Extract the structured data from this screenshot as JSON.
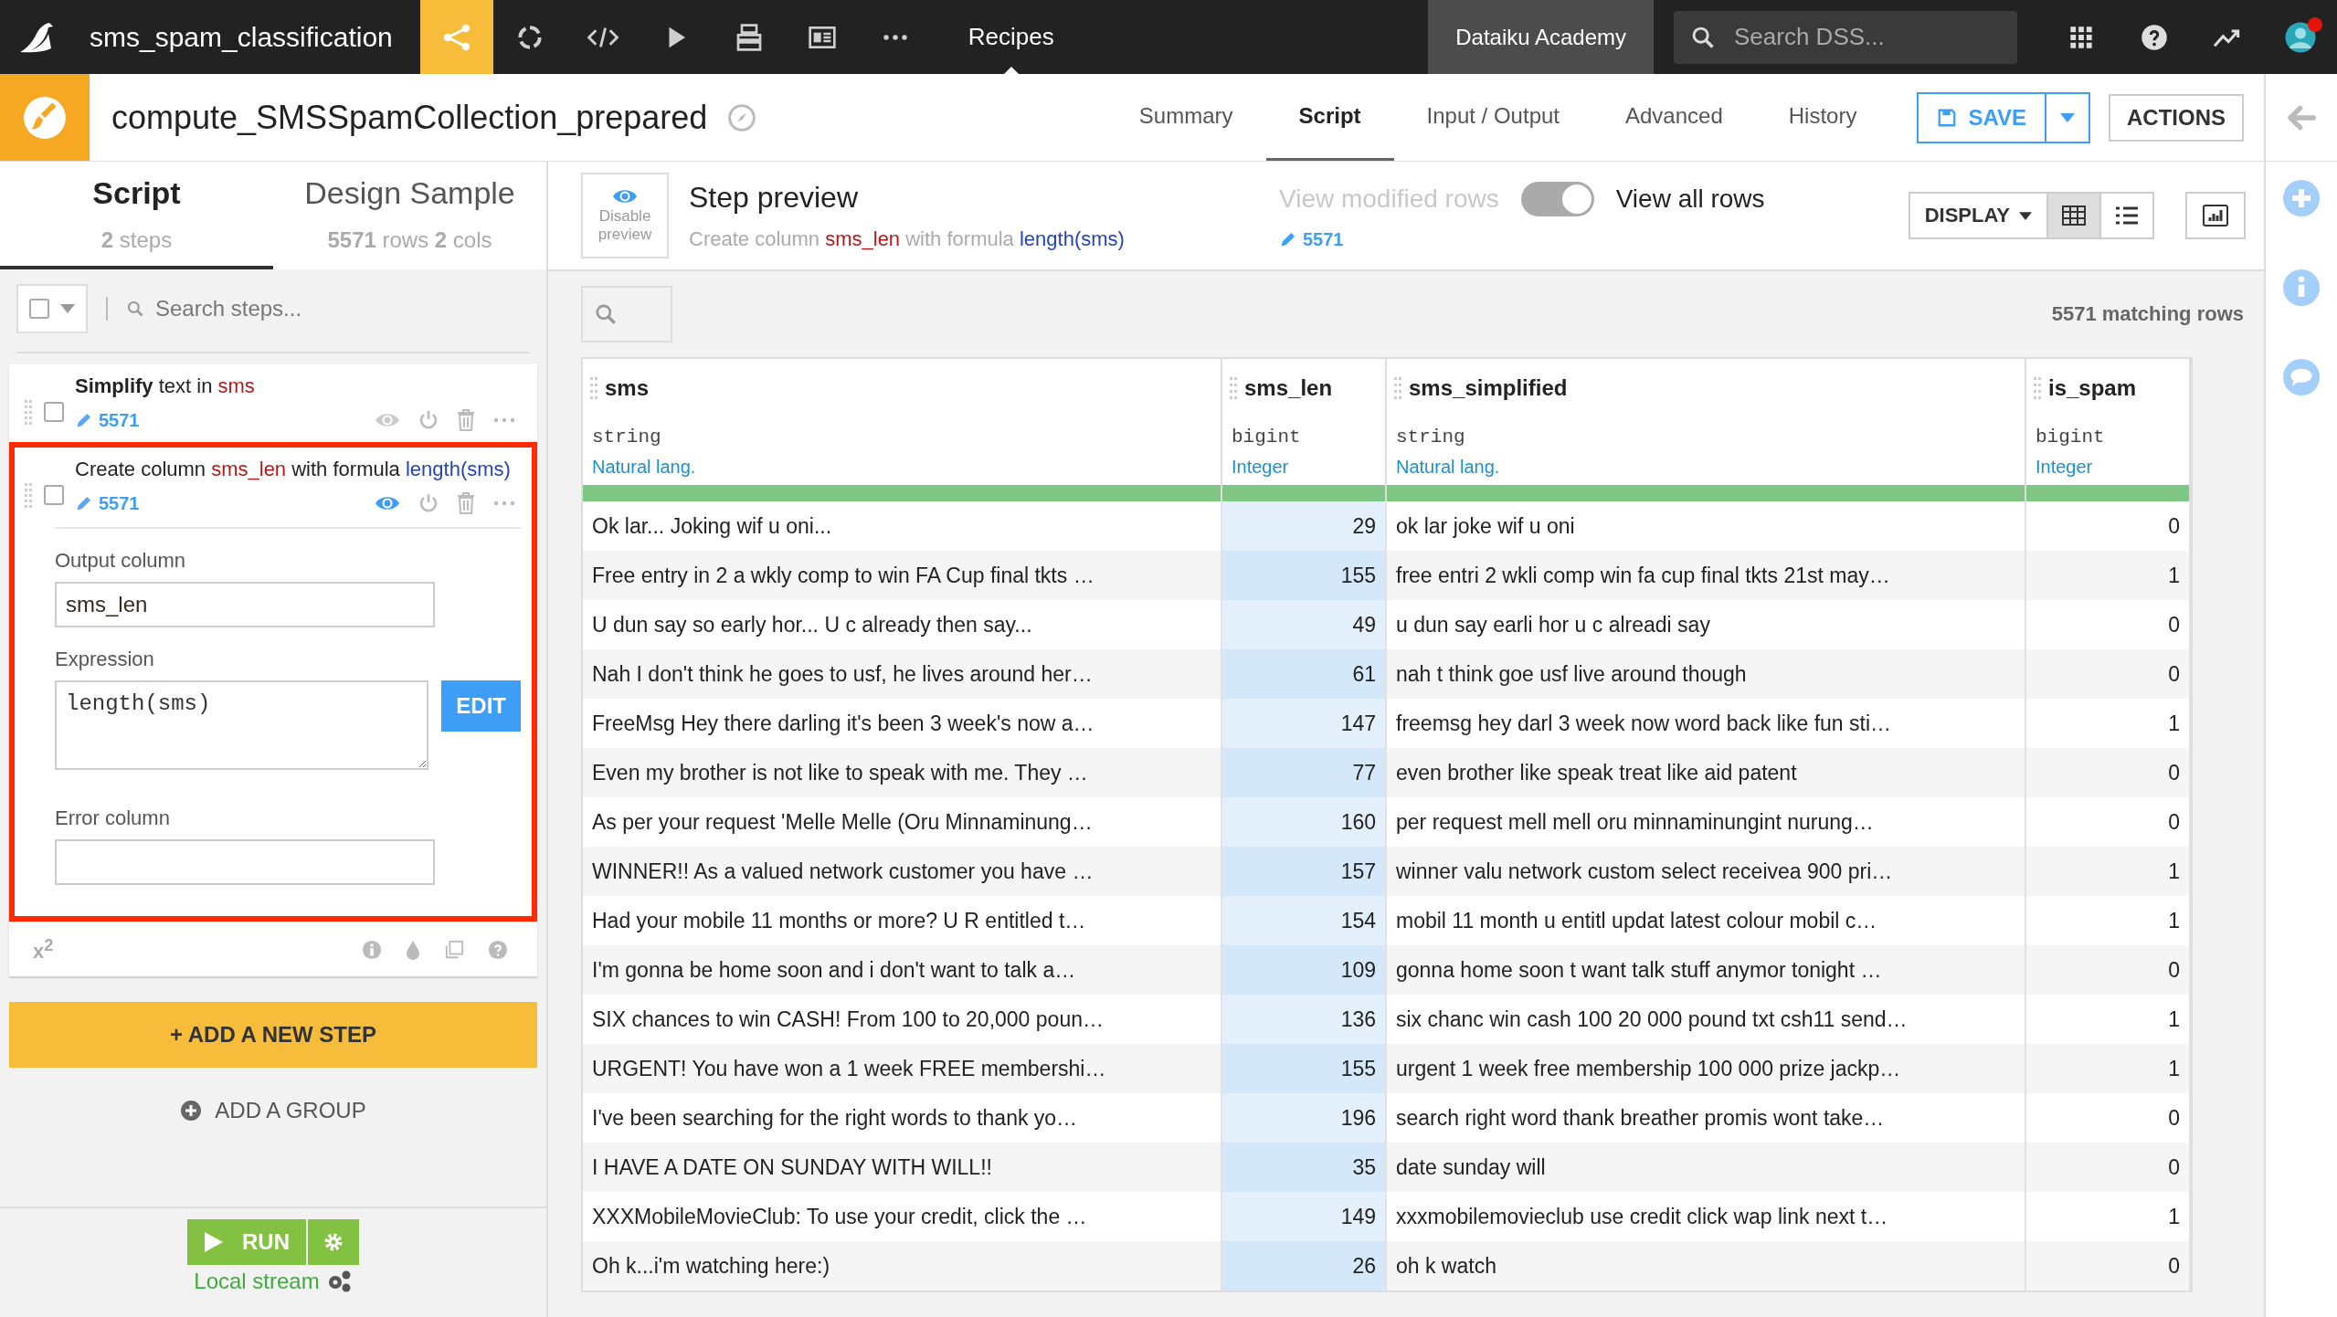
{
  "topbar": {
    "project": "sms_spam_classification",
    "nav": [
      {
        "kind": "flow",
        "selected": true
      },
      {
        "kind": "lab",
        "selected": false
      },
      {
        "kind": "code",
        "selected": false
      },
      {
        "kind": "run",
        "selected": false
      },
      {
        "kind": "deploy",
        "selected": false
      },
      {
        "kind": "dashboard",
        "selected": false
      },
      {
        "kind": "more",
        "selected": false
      }
    ],
    "section": "Recipes",
    "academy": "Dataiku Academy",
    "search": {
      "placeholder": "Search DSS..."
    },
    "notification": true
  },
  "recipe": {
    "title": "compute_SMSSpamCollection_prepared",
    "tabs": [
      {
        "label": "Summary",
        "selected": false
      },
      {
        "label": "Script",
        "selected": true
      },
      {
        "label": "Input / Output",
        "selected": false
      },
      {
        "label": "Advanced",
        "selected": false
      },
      {
        "label": "History",
        "selected": false
      }
    ],
    "save": "SAVE",
    "actions": "ACTIONS"
  },
  "sidebar": {
    "tabs": [
      {
        "label": "Script",
        "sub": "**2** steps",
        "selected": true
      },
      {
        "label": "Design Sample",
        "sub": "**5571** rows **2** cols",
        "selected": false
      }
    ],
    "search": {
      "placeholder": "Search steps..."
    },
    "steps": [
      {
        "title": [
          {
            "text": "Simplify",
            "kind": "action"
          },
          {
            "text": " text in ",
            "kind": "plain"
          },
          {
            "text": "sms",
            "kind": "column"
          }
        ],
        "count": "5571",
        "checked": false,
        "preview": false,
        "highlighted": false
      },
      {
        "title": [
          {
            "text": "Create column ",
            "kind": "plain"
          },
          {
            "text": "sms_len",
            "kind": "column"
          },
          {
            "text": " with formula ",
            "kind": "plain"
          },
          {
            "text": "length(sms)",
            "kind": "formula"
          }
        ],
        "count": "5571",
        "checked": false,
        "preview": true,
        "highlighted": true,
        "fields": [
          {
            "kind": "input",
            "label": "Output column",
            "value": "sms_len"
          },
          {
            "kind": "code",
            "label": "Expression",
            "value": "length(sms)",
            "button": "EDIT"
          },
          {
            "kind": "input",
            "label": "Error column"
          }
        ]
      }
    ],
    "footer": "x$^{2}$",
    "add_step": "+ ADD A NEW STEP",
    "add_group": "ADD A GROUP",
    "run": "RUN",
    "engine": "Local stream"
  },
  "preview": {
    "disable": "Disable preview",
    "title": "Step preview",
    "description": [
      {
        "text": "Create column ",
        "kind": "plain"
      },
      {
        "text": "sms_len",
        "kind": "column"
      },
      {
        "text": " with formula ",
        "kind": "plain"
      },
      {
        "text": "length(sms)",
        "kind": "formula"
      }
    ],
    "modified_label": "View modified rows",
    "all_label": "View all rows",
    "show_all": true,
    "count": "5571",
    "display": "DISPLAY",
    "views": [
      {
        "kind": "table",
        "selected": true
      },
      {
        "kind": "list",
        "selected": false
      }
    ],
    "matching": "5571 matching rows"
  },
  "table": {
    "columns": [
      {
        "name": "sms",
        "type": "string",
        "meaning": "Natural lang.",
        "kind": "text",
        "modified": false
      },
      {
        "name": "sms_len",
        "type": "bigint",
        "meaning": "Integer",
        "kind": "number",
        "modified": true
      },
      {
        "name": "sms_simplified",
        "type": "string",
        "meaning": "Natural lang.",
        "kind": "text",
        "modified": false
      },
      {
        "name": "is_spam",
        "type": "bigint",
        "meaning": "Integer",
        "kind": "number",
        "modified": false
      }
    ],
    "rows": [
      [
        "Ok lar... Joking wif u oni...",
        "29",
        "ok lar joke wif u oni",
        "0"
      ],
      [
        "Free entry in 2 a wkly comp to win FA Cup final tkts …",
        "155",
        "free entri 2 wkli comp win fa cup final tkts 21st may…",
        "1"
      ],
      [
        "U dun say so early hor... U c already then say...",
        "49",
        "u dun say earli hor u c alreadi say",
        "0"
      ],
      [
        "Nah I don't think he goes to usf, he lives around her…",
        "61",
        "nah t think goe usf live around though",
        "0"
      ],
      [
        "FreeMsg Hey there darling it's been 3 week's now a…",
        "147",
        "freemsg hey darl 3 week now word back like fun sti…",
        "1"
      ],
      [
        "Even my brother is not like to speak with me. They …",
        "77",
        "even brother like speak treat like aid patent",
        "0"
      ],
      [
        "As per your request 'Melle Melle (Oru Minnaminung…",
        "160",
        "per request mell mell oru minnaminungint nurung…",
        "0"
      ],
      [
        "WINNER!! As a valued network customer you have …",
        "157",
        "winner valu network custom select receivea 900 pri…",
        "1"
      ],
      [
        "Had your mobile 11 months or more? U R entitled t…",
        "154",
        "mobil 11 month u entitl updat latest colour mobil c…",
        "1"
      ],
      [
        "I'm gonna be home soon and i don't want to talk a…",
        "109",
        "gonna home soon t want talk stuff anymor tonight …",
        "0"
      ],
      [
        "SIX chances to win CASH! From 100 to 20,000 poun…",
        "136",
        "six chanc win cash 100 20 000 pound txt csh11 send…",
        "1"
      ],
      [
        "URGENT! You have won a 1 week FREE membershi…",
        "155",
        "urgent 1 week free membership 100 000 prize jackp…",
        "1"
      ],
      [
        "I've been searching for the right words to thank yo…",
        "196",
        "search right word thank breather promis wont take…",
        "0"
      ],
      [
        "I HAVE A DATE ON SUNDAY WITH WILL!!",
        "35",
        "date sunday will",
        "0"
      ],
      [
        "XXXMobileMovieClub: To use your credit, click the …",
        "149",
        "xxxmobilemovieclub use credit click wap link next t…",
        "1"
      ],
      [
        "Oh k...i'm watching here:)",
        "26",
        "oh k watch",
        "0"
      ]
    ]
  }
}
